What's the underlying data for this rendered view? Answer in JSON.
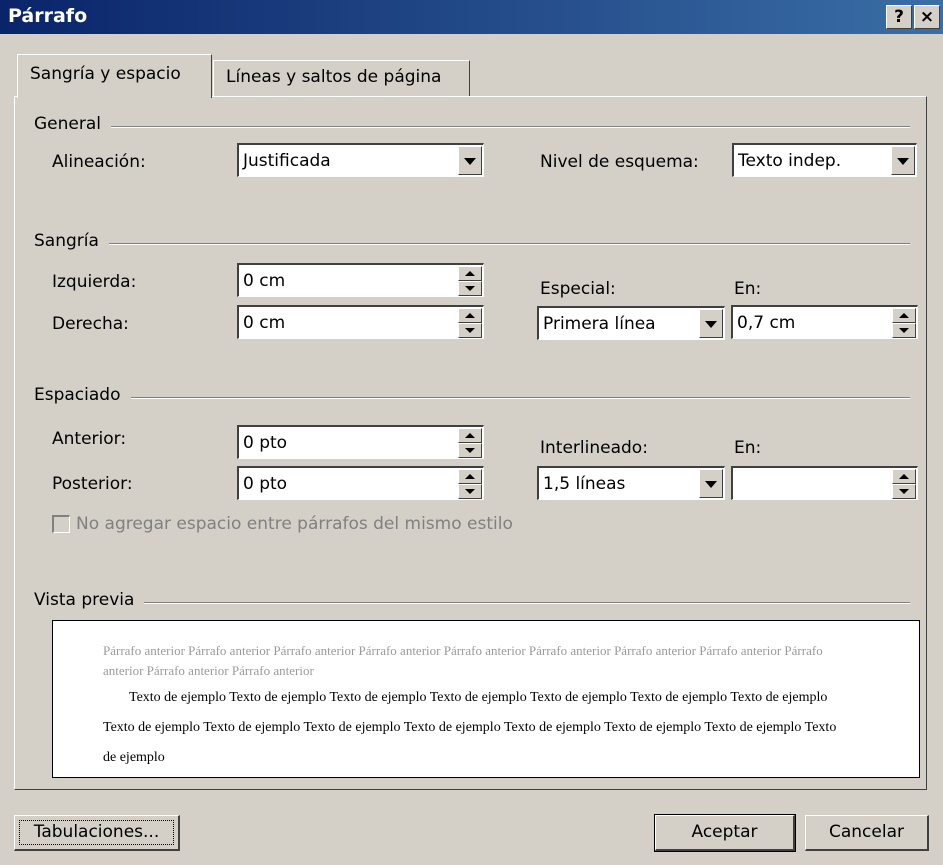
{
  "window": {
    "title": "Párrafo",
    "help_icon": "?",
    "close_icon": "×"
  },
  "tabs": [
    {
      "label": "Sangría y espacio",
      "accesskey": "S",
      "active": true
    },
    {
      "label": "Líneas y saltos de página",
      "accesskey": "p",
      "active": false
    }
  ],
  "general": {
    "label": "General",
    "alineacion_label": "Alineación:",
    "alineacion_value": "Justificada",
    "nivel_label": "Nivel de esquema:",
    "nivel_value": "Texto indep."
  },
  "sangria": {
    "label": "Sangría",
    "izquierda_label": "Izquierda:",
    "izquierda_value": "0 cm",
    "derecha_label": "Derecha:",
    "derecha_value": "0 cm",
    "especial_label": "Especial:",
    "especial_value": "Primera línea",
    "en_label": "En:",
    "en_value": "0,7 cm"
  },
  "espaciado": {
    "label": "Espaciado",
    "anterior_label": "Anterior:",
    "anterior_value": "0 pto",
    "posterior_label": "Posterior:",
    "posterior_value": "0 pto",
    "interlineado_label": "Interlineado:",
    "interlineado_value": "1,5 líneas",
    "en_label": "En:",
    "en_value": "",
    "checkbox_label": "No agregar espacio entre párrafos del mismo estilo",
    "checkbox_checked": false
  },
  "preview": {
    "label": "Vista previa",
    "previous_text": "Párrafo anterior Párrafo anterior Párrafo anterior Párrafo anterior Párrafo anterior Párrafo anterior Párrafo anterior Párrafo anterior Párrafo anterior Párrafo anterior Párrafo anterior",
    "sample_text": "Texto de ejemplo Texto de ejemplo Texto de ejemplo Texto de ejemplo Texto de ejemplo Texto de ejemplo Texto de ejemplo Texto de ejemplo Texto de ejemplo Texto de ejemplo Texto de ejemplo Texto de ejemplo Texto de ejemplo Texto de ejemplo Texto de ejemplo"
  },
  "buttons": {
    "tabulaciones": "Tabulaciones...",
    "aceptar": "Aceptar",
    "cancelar": "Cancelar"
  },
  "colors": {
    "titlebar_start": "#0a246a",
    "titlebar_end": "#3a6ea5",
    "face": "#d4d0c8"
  }
}
